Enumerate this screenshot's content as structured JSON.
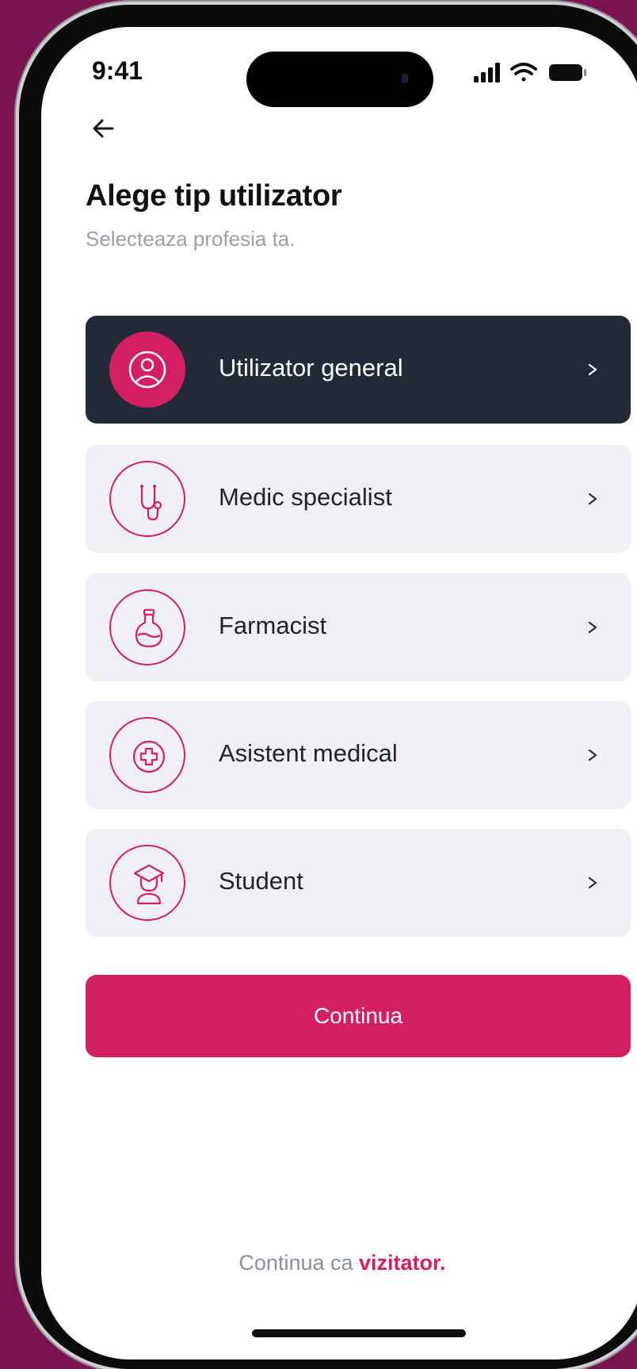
{
  "status_bar": {
    "time": "9:41",
    "icons": [
      "signal-icon",
      "wifi-icon",
      "battery-icon"
    ]
  },
  "header": {
    "back_icon": "arrow-left-icon",
    "title": "Alege tip utilizator",
    "subtitle": "Selecteaza profesia ta."
  },
  "options": [
    {
      "label": "Utilizator general",
      "icon": "user-circle-icon",
      "selected": true
    },
    {
      "label": "Medic specialist",
      "icon": "stethoscope-icon",
      "selected": false
    },
    {
      "label": "Farmacist",
      "icon": "potion-flask-icon",
      "selected": false
    },
    {
      "label": "Asistent medical",
      "icon": "medical-cross-icon",
      "selected": false
    },
    {
      "label": "Student",
      "icon": "graduate-icon",
      "selected": false
    }
  ],
  "chevron_glyph": ">",
  "cta": {
    "label": "Continua"
  },
  "footer": {
    "prefix": "Continua ca ",
    "link": "vizitator."
  },
  "colors": {
    "accent": "#d41f63",
    "selected_card": "#222937",
    "card": "#efeff4",
    "background": "#7a1451"
  }
}
